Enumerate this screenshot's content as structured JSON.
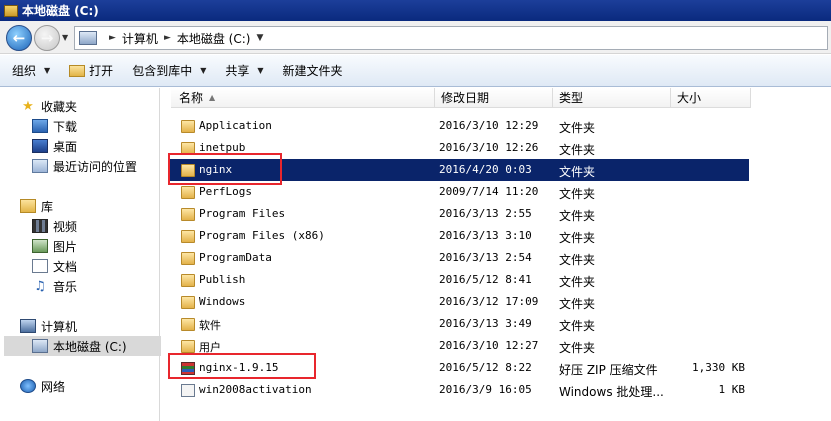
{
  "window": {
    "title": "本地磁盘 (C:)"
  },
  "address": {
    "crumbs": [
      "计算机",
      "本地磁盘 (C:)"
    ]
  },
  "toolbar": {
    "organize": "组织",
    "open": "打开",
    "include_library": "包含到库中",
    "share": "共享",
    "new_folder": "新建文件夹"
  },
  "sidebar": {
    "favorites": {
      "label": "收藏夹",
      "items": [
        "下载",
        "桌面",
        "最近访问的位置"
      ]
    },
    "libraries": {
      "label": "库",
      "items": [
        "视频",
        "图片",
        "文档",
        "音乐"
      ]
    },
    "computer": {
      "label": "计算机",
      "items": [
        "本地磁盘 (C:)"
      ]
    },
    "network": {
      "label": "网络"
    }
  },
  "columns": {
    "name": "名称",
    "modified": "修改日期",
    "type": "类型",
    "size": "大小"
  },
  "files": [
    {
      "name": "Application",
      "modified": "2016/3/10 12:29",
      "type": "文件夹",
      "size": "",
      "icon": "folder-icon"
    },
    {
      "name": "inetpub",
      "modified": "2016/3/10 12:26",
      "type": "文件夹",
      "size": "",
      "icon": "folder-icon"
    },
    {
      "name": "nginx",
      "modified": "2016/4/20 0:03",
      "type": "文件夹",
      "size": "",
      "icon": "folder-icon"
    },
    {
      "name": "PerfLogs",
      "modified": "2009/7/14 11:20",
      "type": "文件夹",
      "size": "",
      "icon": "folder-icon"
    },
    {
      "name": "Program Files",
      "modified": "2016/3/13 2:55",
      "type": "文件夹",
      "size": "",
      "icon": "folder-icon"
    },
    {
      "name": "Program Files (x86)",
      "modified": "2016/3/13 3:10",
      "type": "文件夹",
      "size": "",
      "icon": "folder-icon"
    },
    {
      "name": "ProgramData",
      "modified": "2016/3/13 2:54",
      "type": "文件夹",
      "size": "",
      "icon": "folder-icon"
    },
    {
      "name": "Publish",
      "modified": "2016/5/12 8:41",
      "type": "文件夹",
      "size": "",
      "icon": "folder-icon"
    },
    {
      "name": "Windows",
      "modified": "2016/3/12 17:09",
      "type": "文件夹",
      "size": "",
      "icon": "folder-icon"
    },
    {
      "name": "软件",
      "modified": "2016/3/13 3:49",
      "type": "文件夹",
      "size": "",
      "icon": "folder-icon"
    },
    {
      "name": "用户",
      "modified": "2016/3/10 12:27",
      "type": "文件夹",
      "size": "",
      "icon": "folder-icon"
    },
    {
      "name": "nginx-1.9.15",
      "modified": "2016/5/12 8:22",
      "type": "好压 ZIP 压缩文件",
      "size": "1,330 KB",
      "icon": "zip-icon"
    },
    {
      "name": "win2008activation",
      "modified": "2016/3/9 16:05",
      "type": "Windows 批处理...",
      "size": "1 KB",
      "icon": "batch-file-icon"
    }
  ],
  "selected_file": "nginx",
  "highlight_color": "#e8262d",
  "selection_color": "#0a246a"
}
